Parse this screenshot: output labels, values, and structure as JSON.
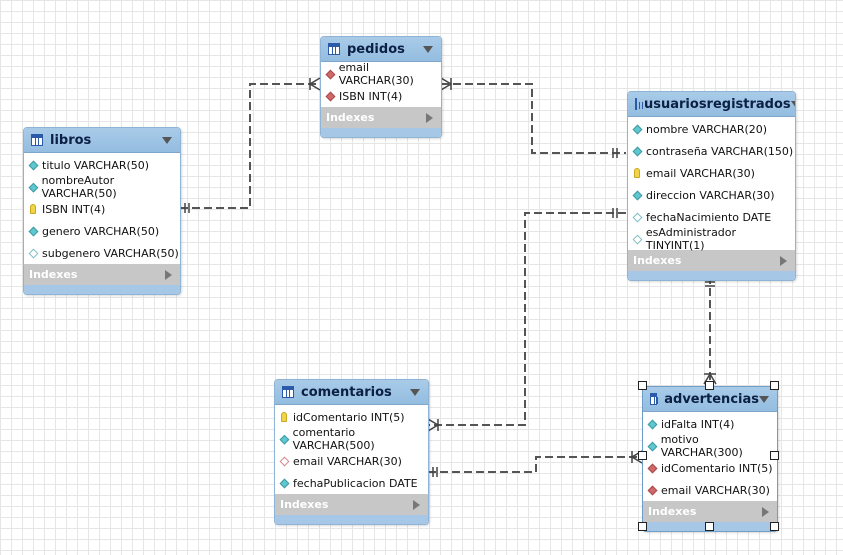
{
  "indexes_label": "Indexes",
  "tables": {
    "pedidos": {
      "name": "pedidos",
      "columns": [
        {
          "text": "email VARCHAR(30)",
          "icon": "fk"
        },
        {
          "text": "ISBN INT(4)",
          "icon": "fk"
        }
      ]
    },
    "libros": {
      "name": "libros",
      "columns": [
        {
          "text": "titulo VARCHAR(50)",
          "icon": "nn"
        },
        {
          "text": "nombreAutor VARCHAR(50)",
          "icon": "nn"
        },
        {
          "text": "ISBN INT(4)",
          "icon": "pk"
        },
        {
          "text": "genero VARCHAR(50)",
          "icon": "nn"
        },
        {
          "text": "subgenero VARCHAR(50)",
          "icon": "nl"
        }
      ]
    },
    "usuariosregistrados": {
      "name": "usuariosregistrados",
      "columns": [
        {
          "text": "nombre VARCHAR(20)",
          "icon": "nn"
        },
        {
          "text": "contraseña VARCHAR(150)",
          "icon": "nn"
        },
        {
          "text": "email VARCHAR(30)",
          "icon": "pk"
        },
        {
          "text": "direccion VARCHAR(30)",
          "icon": "nn"
        },
        {
          "text": "fechaNacimiento DATE",
          "icon": "nl"
        },
        {
          "text": "esAdministrador TINYINT(1)",
          "icon": "nl"
        }
      ]
    },
    "comentarios": {
      "name": "comentarios",
      "columns": [
        {
          "text": "idComentario INT(5)",
          "icon": "pk"
        },
        {
          "text": "comentario VARCHAR(500)",
          "icon": "nn"
        },
        {
          "text": "email VARCHAR(30)",
          "icon": "fko"
        },
        {
          "text": "fechaPublicacion DATE",
          "icon": "nn"
        }
      ]
    },
    "advertencias": {
      "name": "advertencias",
      "columns": [
        {
          "text": "idFalta INT(4)",
          "icon": "nn"
        },
        {
          "text": "motivo VARCHAR(300)",
          "icon": "nn"
        },
        {
          "text": "idComentario INT(5)",
          "icon": "fk"
        },
        {
          "text": "email VARCHAR(30)",
          "icon": "fk"
        }
      ]
    }
  },
  "relationships": [
    {
      "from": "libros",
      "to": "pedidos",
      "type": "one-to-many"
    },
    {
      "from": "usuariosregistrados",
      "to": "pedidos",
      "type": "one-to-many"
    },
    {
      "from": "usuariosregistrados",
      "to": "comentarios",
      "type": "one-to-many"
    },
    {
      "from": "usuariosregistrados",
      "to": "advertencias",
      "type": "one-to-many"
    },
    {
      "from": "comentarios",
      "to": "advertencias",
      "type": "one-to-many"
    }
  ],
  "selected_table": "advertencias"
}
